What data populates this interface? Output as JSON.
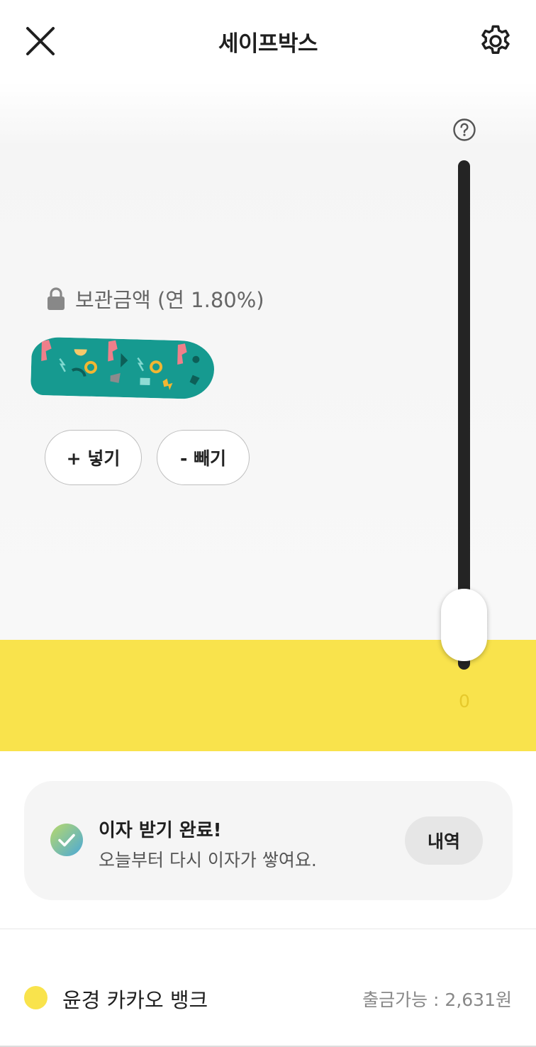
{
  "header": {
    "title": "세이프박스"
  },
  "box": {
    "balance_label": "보관금액 (연 1.80%)",
    "deposit_label": "+ 넣기",
    "withdraw_label": "- 빼기"
  },
  "slider": {
    "min_label": "0",
    "level": 0
  },
  "notice": {
    "title": "이자 받기 완료!",
    "subtitle": "오늘부터 다시 이자가 쌓여요.",
    "history_label": "내역"
  },
  "account": {
    "name": "윤경 카카오 뱅크",
    "balance": "출금가능 : 2,631원"
  },
  "colors": {
    "accent_yellow": "#f9e34c",
    "track": "#242424",
    "check_gradient_start": "#b9d96a",
    "check_gradient_end": "#4aa8d8"
  },
  "icons": {
    "close": "close-icon",
    "settings": "gear-icon",
    "help": "question-icon",
    "lock": "lock-icon",
    "check": "check-circle-icon"
  }
}
